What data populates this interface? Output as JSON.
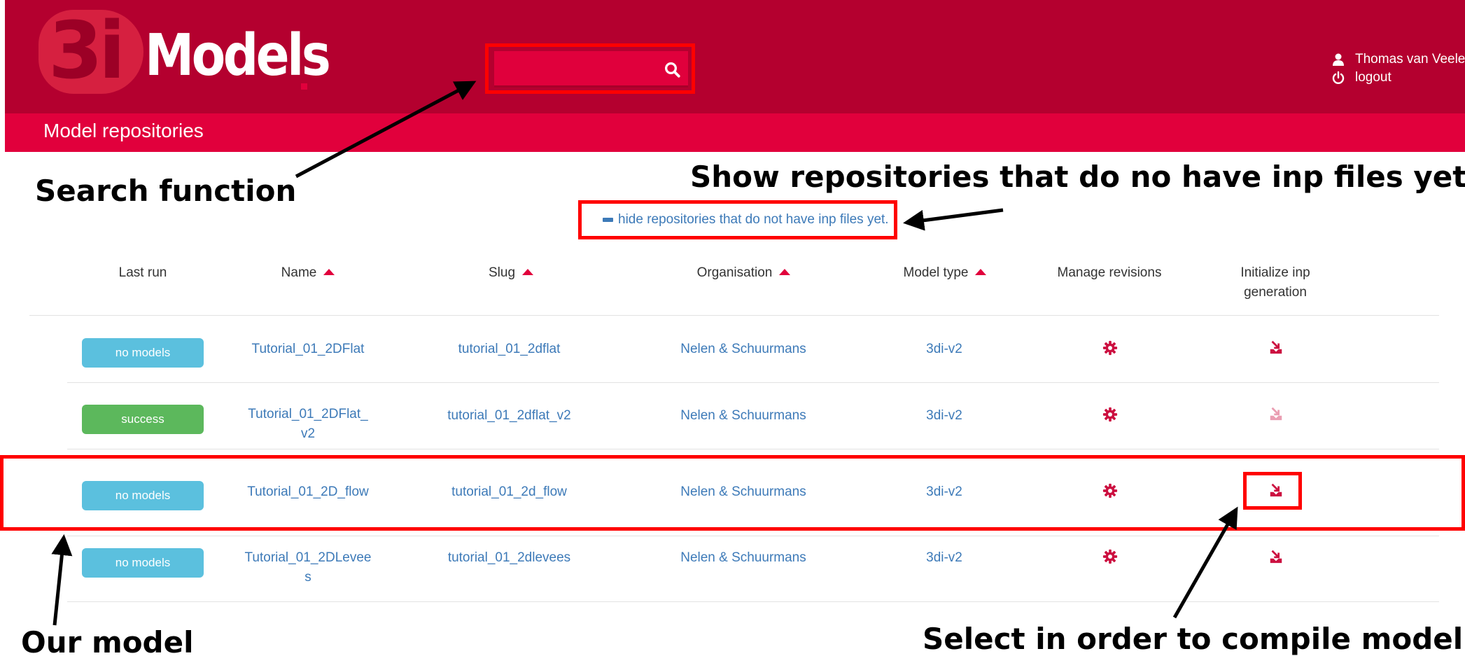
{
  "header": {
    "logo_number": "3i",
    "logo_text": "Models",
    "search": {
      "value": "",
      "placeholder": ""
    },
    "user_name": "Thomas van Veelen",
    "logout_label": "logout",
    "brand_color": "#b4002f",
    "accent_color": "#e1003c"
  },
  "subheader": {
    "title": "Model repositories"
  },
  "filter_toggle": {
    "label": "hide repositories that do not have inp files yet."
  },
  "table": {
    "columns": [
      "Last run",
      "Name",
      "Slug",
      "Organisation",
      "Model type",
      "Manage revisions",
      "Initialize inp generation"
    ],
    "rows": [
      {
        "last_run": "no models",
        "status": "info",
        "name": "Tutorial_01_2DFlat",
        "slug": "tutorial_01_2dflat",
        "organisation": "Nelen & Schuurmans",
        "model_type": "3di-v2",
        "inp_enabled": true
      },
      {
        "last_run": "success",
        "status": "success",
        "name": "Tutorial_01_2DFlat_\nv2",
        "slug": "tutorial_01_2dflat_v2",
        "organisation": "Nelen & Schuurmans",
        "model_type": "3di-v2",
        "inp_enabled": false
      },
      {
        "last_run": "no models",
        "status": "info",
        "name": "Tutorial_01_2D_flow",
        "slug": "tutorial_01_2d_flow",
        "organisation": "Nelen & Schuurmans",
        "model_type": "3di-v2",
        "inp_enabled": true
      },
      {
        "last_run": "no models",
        "status": "info",
        "name": "Tutorial_01_2DLevee\ns",
        "slug": "tutorial_01_2dlevees",
        "organisation": "Nelen & Schuurmans",
        "model_type": "3di-v2",
        "inp_enabled": true
      }
    ]
  },
  "annotations": {
    "search": "Search function",
    "show_repos": "Show repositories that do no have inp files yet",
    "our_model": "Our model",
    "select": "Select in order to compile model"
  },
  "icons": {
    "search": "search-icon",
    "user": "user-icon",
    "logout": "power-icon",
    "sort": "sort-up-icon",
    "manage": "gear-icon",
    "inp": "download-icon",
    "toggle": "minus-icon"
  }
}
